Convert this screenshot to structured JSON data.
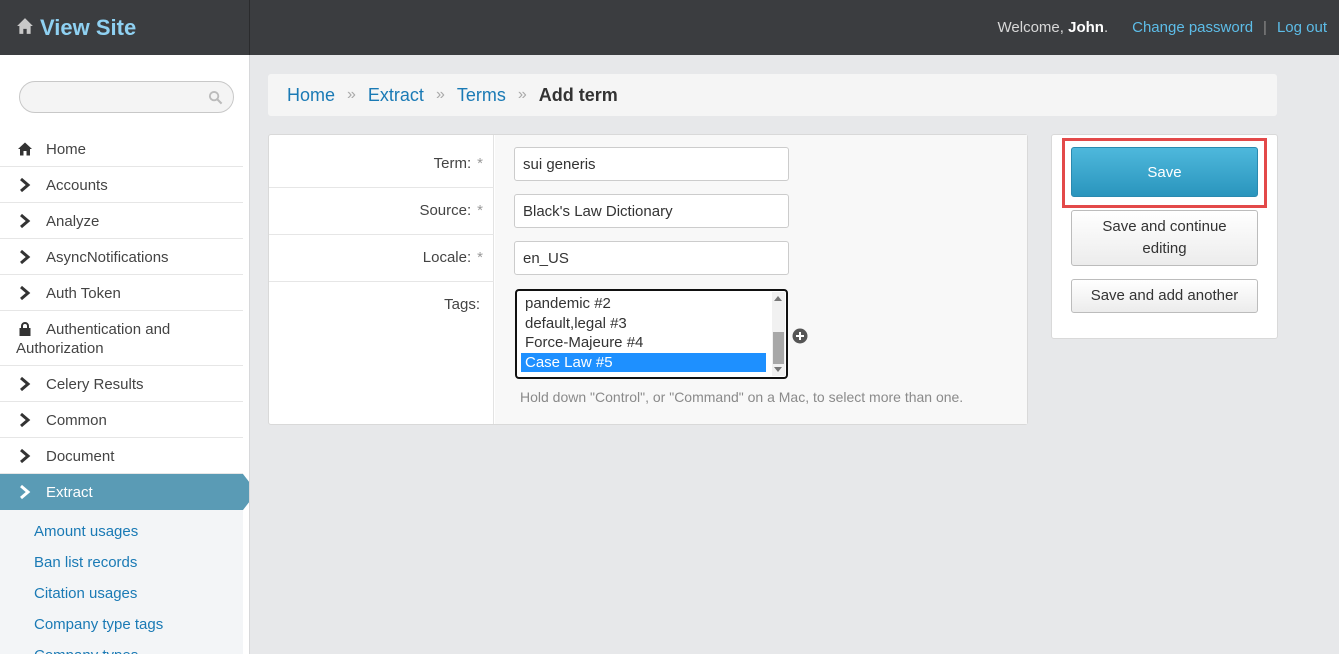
{
  "header": {
    "brand": "View Site",
    "welcome_prefix": "Welcome, ",
    "user": "John",
    "welcome_suffix": ".",
    "change_password": "Change password",
    "separator": "|",
    "logout": "Log out"
  },
  "sidebar": {
    "search_placeholder": "",
    "items": [
      {
        "label": "Home",
        "icon": "home-icon"
      },
      {
        "label": "Accounts",
        "icon": "chevron-right-icon"
      },
      {
        "label": "Analyze",
        "icon": "chevron-right-icon"
      },
      {
        "label": "AsyncNotifications",
        "icon": "chevron-right-icon"
      },
      {
        "label": "Auth Token",
        "icon": "chevron-right-icon"
      },
      {
        "label": "Authentication and Authorization",
        "icon": "lock-icon"
      },
      {
        "label": "Celery Results",
        "icon": "chevron-right-icon"
      },
      {
        "label": "Common",
        "icon": "chevron-right-icon"
      },
      {
        "label": "Document",
        "icon": "chevron-right-icon"
      },
      {
        "label": "Extract",
        "icon": "chevron-right-icon"
      }
    ],
    "subitems": [
      "Amount usages",
      "Ban list records",
      "Citation usages",
      "Company type tags",
      "Company types"
    ]
  },
  "breadcrumb": {
    "items": [
      "Home",
      "Extract",
      "Terms"
    ],
    "separator": "»",
    "current": "Add term"
  },
  "form": {
    "term_label": "Term:",
    "term_value": "sui generis",
    "source_label": "Source:",
    "source_value": "Black's Law Dictionary",
    "locale_label": "Locale:",
    "locale_value": "en_US",
    "tags_label": "Tags:",
    "required_mark": "*",
    "tags_options": [
      "pandemic #2",
      "default,legal #3",
      "Force-Majeure #4",
      "Case Law #5"
    ],
    "tags_selected": "Case Law #5",
    "help_text": "Hold down \"Control\", or \"Command\" on a Mac, to select more than one."
  },
  "submit": {
    "save": "Save",
    "save_continue": "Save and continue editing",
    "save_another": "Save and add another"
  },
  "colors": {
    "header_bg": "#3b3d40",
    "brand": "#8fd1f2",
    "link": "#1a7ab5",
    "active_nav": "#5a9bb5",
    "save_button": "#3aa6cd",
    "highlight": "#e34949",
    "selected_option": "#1e90ff"
  }
}
